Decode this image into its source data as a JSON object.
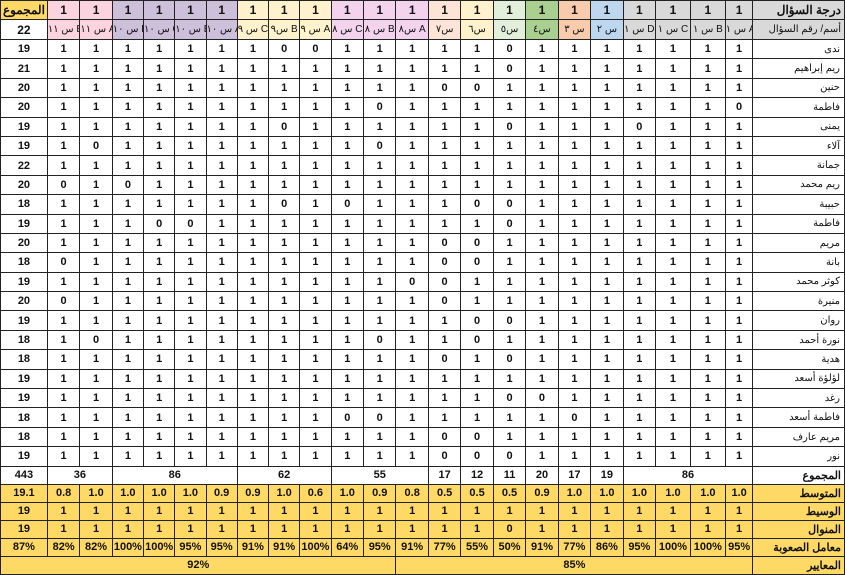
{
  "columns": [
    {
      "label": "أسم/ رقم السؤال",
      "color": "#d9d9d9"
    },
    {
      "label": "س ١ A",
      "color": "#d9d9d9"
    },
    {
      "label": "س ١ B",
      "color": "#d9d9d9"
    },
    {
      "label": "س ١ C",
      "color": "#d9d9d9"
    },
    {
      "label": "س ١ D",
      "color": "#d9d9d9"
    },
    {
      "label": "س ٢",
      "color": "#bdd7ee"
    },
    {
      "label": "س ٣",
      "color": "#f8cbad"
    },
    {
      "label": "س٤",
      "color": "#a9d08e"
    },
    {
      "label": "س٥",
      "color": "#e2efda"
    },
    {
      "label": "س٦",
      "color": "#fff2cc"
    },
    {
      "label": "س٧",
      "color": "#fce4d6"
    },
    {
      "label": "س٨ A",
      "color": "#f4d3ef"
    },
    {
      "label": "س ٨ B",
      "color": "#f4d3ef"
    },
    {
      "label": "س ٨ C",
      "color": "#f4d3ef"
    },
    {
      "label": "س ٩ A",
      "color": "#fff2cc"
    },
    {
      "label": "س٩ B",
      "color": "#fff2cc"
    },
    {
      "label": "س ٩ C",
      "color": "#fff2cc"
    },
    {
      "label": "س ١٠ A",
      "color": "#ccc0da"
    },
    {
      "label": "س ١٠ B",
      "color": "#ccc0da"
    },
    {
      "label": "س ١٠ C",
      "color": "#ccc0da"
    },
    {
      "label": "س ١٠ D",
      "color": "#ccc0da"
    },
    {
      "label": "س ١١ A",
      "color": "#fbd4e0"
    },
    {
      "label": "س ١١ B",
      "color": "#fbd4e0"
    },
    {
      "label": "المجموع",
      "color": "#ffd966"
    }
  ],
  "grade_row": {
    "label": "درجة السؤال",
    "values": [
      "1",
      "1",
      "1",
      "1",
      "1",
      "1",
      "1",
      "1",
      "1",
      "1",
      "1",
      "1",
      "1",
      "1",
      "1",
      "1",
      "1",
      "1",
      "1",
      "1",
      "1",
      "1"
    ],
    "total": "22"
  },
  "students": [
    {
      "name": "ندى",
      "v": [
        "1",
        "1",
        "1",
        "1",
        "1",
        "1",
        "1",
        "0",
        "1",
        "1",
        "1",
        "1",
        "1",
        "0",
        "0",
        "1",
        "1",
        "1",
        "1",
        "1",
        "1",
        "1"
      ],
      "total": "19"
    },
    {
      "name": "ريم إبراهيم",
      "v": [
        "1",
        "1",
        "1",
        "1",
        "1",
        "1",
        "1",
        "0",
        "1",
        "1",
        "1",
        "1",
        "1",
        "1",
        "1",
        "1",
        "1",
        "1",
        "1",
        "1",
        "1",
        "1"
      ],
      "total": "21"
    },
    {
      "name": "حنين",
      "v": [
        "1",
        "1",
        "1",
        "1",
        "1",
        "1",
        "1",
        "1",
        "0",
        "0",
        "1",
        "1",
        "1",
        "1",
        "1",
        "1",
        "1",
        "1",
        "1",
        "1",
        "1",
        "1"
      ],
      "total": "20"
    },
    {
      "name": "فاطمة",
      "v": [
        "0",
        "1",
        "1",
        "1",
        "1",
        "1",
        "1",
        "1",
        "1",
        "1",
        "1",
        "0",
        "1",
        "1",
        "1",
        "1",
        "1",
        "1",
        "1",
        "1",
        "1",
        "1"
      ],
      "total": "20"
    },
    {
      "name": "يمنى",
      "v": [
        "1",
        "1",
        "1",
        "0",
        "1",
        "1",
        "1",
        "0",
        "1",
        "1",
        "1",
        "1",
        "1",
        "1",
        "0",
        "1",
        "1",
        "1",
        "1",
        "1",
        "1",
        "1"
      ],
      "total": "19"
    },
    {
      "name": "آلاء",
      "v": [
        "1",
        "1",
        "1",
        "1",
        "1",
        "1",
        "1",
        "1",
        "1",
        "1",
        "1",
        "0",
        "1",
        "1",
        "1",
        "1",
        "1",
        "1",
        "1",
        "1",
        "0",
        "1"
      ],
      "total": "19"
    },
    {
      "name": "جمانة",
      "v": [
        "1",
        "1",
        "1",
        "1",
        "1",
        "1",
        "1",
        "1",
        "1",
        "1",
        "1",
        "1",
        "1",
        "1",
        "1",
        "1",
        "1",
        "1",
        "1",
        "1",
        "1",
        "1"
      ],
      "total": "22"
    },
    {
      "name": "ريم محمد",
      "v": [
        "1",
        "1",
        "1",
        "1",
        "1",
        "1",
        "1",
        "1",
        "1",
        "1",
        "1",
        "1",
        "1",
        "1",
        "1",
        "1",
        "1",
        "1",
        "1",
        "0",
        "1",
        "0"
      ],
      "total": "20"
    },
    {
      "name": "حبيبة",
      "v": [
        "1",
        "1",
        "1",
        "1",
        "1",
        "1",
        "1",
        "0",
        "0",
        "1",
        "1",
        "1",
        "0",
        "1",
        "0",
        "1",
        "1",
        "1",
        "1",
        "1",
        "1",
        "1"
      ],
      "total": "18"
    },
    {
      "name": "فاطمة",
      "v": [
        "1",
        "1",
        "1",
        "1",
        "1",
        "1",
        "1",
        "0",
        "1",
        "1",
        "1",
        "1",
        "1",
        "1",
        "1",
        "1",
        "1",
        "0",
        "0",
        "1",
        "1",
        "1"
      ],
      "total": "19"
    },
    {
      "name": "مريم",
      "v": [
        "1",
        "1",
        "1",
        "1",
        "1",
        "1",
        "1",
        "1",
        "0",
        "0",
        "1",
        "1",
        "1",
        "1",
        "1",
        "1",
        "1",
        "1",
        "1",
        "1",
        "1",
        "1"
      ],
      "total": "20"
    },
    {
      "name": "بانة",
      "v": [
        "1",
        "1",
        "1",
        "1",
        "1",
        "1",
        "1",
        "1",
        "0",
        "0",
        "1",
        "1",
        "1",
        "1",
        "1",
        "1",
        "1",
        "1",
        "1",
        "1",
        "1",
        "0"
      ],
      "total": "18"
    },
    {
      "name": "كوثر محمد",
      "v": [
        "1",
        "1",
        "1",
        "1",
        "1",
        "1",
        "1",
        "1",
        "1",
        "0",
        "0",
        "1",
        "1",
        "1",
        "1",
        "1",
        "1",
        "1",
        "1",
        "1",
        "1",
        "1"
      ],
      "total": "19"
    },
    {
      "name": "منيرة",
      "v": [
        "1",
        "1",
        "1",
        "1",
        "1",
        "1",
        "1",
        "1",
        "1",
        "0",
        "1",
        "1",
        "1",
        "1",
        "1",
        "1",
        "1",
        "1",
        "1",
        "1",
        "1",
        "0"
      ],
      "total": "20"
    },
    {
      "name": "روان",
      "v": [
        "1",
        "1",
        "1",
        "1",
        "1",
        "1",
        "1",
        "0",
        "0",
        "1",
        "1",
        "1",
        "1",
        "1",
        "1",
        "1",
        "1",
        "1",
        "1",
        "1",
        "1",
        "1"
      ],
      "total": "19"
    },
    {
      "name": "نورة أحمد",
      "v": [
        "1",
        "1",
        "1",
        "1",
        "1",
        "1",
        "1",
        "1",
        "0",
        "1",
        "1",
        "0",
        "1",
        "1",
        "1",
        "1",
        "1",
        "1",
        "1",
        "1",
        "0",
        "1"
      ],
      "total": "18"
    },
    {
      "name": "هدية",
      "v": [
        "1",
        "1",
        "1",
        "1",
        "1",
        "1",
        "1",
        "0",
        "1",
        "0",
        "1",
        "1",
        "1",
        "1",
        "1",
        "1",
        "1",
        "1",
        "1",
        "1",
        "1",
        "1"
      ],
      "total": "18"
    },
    {
      "name": "لؤلؤة أسعد",
      "v": [
        "1",
        "1",
        "1",
        "1",
        "1",
        "1",
        "1",
        "1",
        "1",
        "1",
        "1",
        "1",
        "1",
        "1",
        "1",
        "1",
        "1",
        "1",
        "1",
        "1",
        "1",
        "1"
      ],
      "total": "19"
    },
    {
      "name": "رغد",
      "v": [
        "1",
        "1",
        "1",
        "1",
        "1",
        "1",
        "0",
        "0",
        "1",
        "1",
        "1",
        "1",
        "1",
        "1",
        "1",
        "1",
        "1",
        "1",
        "1",
        "1",
        "1",
        "1"
      ],
      "total": "19"
    },
    {
      "name": "فاطمة أسعد",
      "v": [
        "1",
        "1",
        "1",
        "1",
        "1",
        "0",
        "1",
        "1",
        "1",
        "1",
        "1",
        "0",
        "0",
        "1",
        "1",
        "1",
        "1",
        "1",
        "1",
        "1",
        "1",
        "1"
      ],
      "total": "18"
    },
    {
      "name": "مريم عارف",
      "v": [
        "1",
        "1",
        "1",
        "1",
        "1",
        "1",
        "1",
        "1",
        "0",
        "0",
        "1",
        "1",
        "1",
        "1",
        "1",
        "1",
        "1",
        "1",
        "1",
        "1",
        "1",
        "1"
      ],
      "total": "18"
    },
    {
      "name": "نور",
      "v": [
        "1",
        "1",
        "1",
        "1",
        "1",
        "1",
        "1",
        "0",
        "0",
        "0",
        "1",
        "1",
        "1",
        "1",
        "1",
        "1",
        "1",
        "1",
        "1",
        "1",
        "1",
        "1"
      ],
      "total": "19"
    }
  ],
  "sums": {
    "label": "المجموع",
    "groups": [
      {
        "span": 4,
        "text": "86"
      },
      {
        "span": 1,
        "text": "19"
      },
      {
        "span": 1,
        "text": "17"
      },
      {
        "span": 1,
        "text": "20"
      },
      {
        "span": 1,
        "text": "11"
      },
      {
        "span": 1,
        "text": "12"
      },
      {
        "span": 1,
        "text": "17"
      },
      {
        "span": 3,
        "text": "55"
      },
      {
        "span": 3,
        "text": "62"
      },
      {
        "span": 4,
        "text": "86"
      },
      {
        "span": 2,
        "text": "36"
      }
    ],
    "total": "443"
  },
  "stats": [
    {
      "label": "المتوسط",
      "values": [
        "1.0",
        "1.0",
        "1.0",
        "1.0",
        "1.0",
        "1.0",
        "0.9",
        "0.5",
        "0.5",
        "0.5",
        "0.8",
        "0.9",
        "1.0",
        "0.6",
        "1.0",
        "0.9",
        "0.9",
        "1.0",
        "1.0",
        "1.0",
        "1.0",
        "0.8"
      ],
      "total": "19.1",
      "last": "0.8"
    },
    {
      "label": "الوسيط",
      "values": [
        "1",
        "1",
        "1",
        "1",
        "1",
        "1",
        "1",
        "1",
        "1",
        "1",
        "1",
        "1",
        "1",
        "1",
        "1",
        "1",
        "1",
        "1",
        "1",
        "1",
        "1",
        "1"
      ],
      "total": "19",
      "mid": "0.5"
    },
    {
      "label": "المنوال",
      "values": [
        "1",
        "1",
        "1",
        "1",
        "1",
        "1",
        "1",
        "0",
        "1",
        "1",
        "1",
        "1",
        "1",
        "1",
        "1",
        "1",
        "1",
        "1",
        "1",
        "1",
        "1",
        "1"
      ],
      "total": "19"
    },
    {
      "label": "معامل الصعوبة",
      "values": [
        "95%",
        "100%",
        "100%",
        "95%",
        "86%",
        "77%",
        "91%",
        "50%",
        "55%",
        "77%",
        "91%",
        "95%",
        "64%",
        "100%",
        "91%",
        "91%",
        "95%",
        "95%",
        "100%",
        "100%",
        "82%",
        "82%"
      ],
      "total": "87%"
    }
  ],
  "criteria": {
    "label": "المعايير",
    "right": "85%",
    "left": "92%"
  }
}
